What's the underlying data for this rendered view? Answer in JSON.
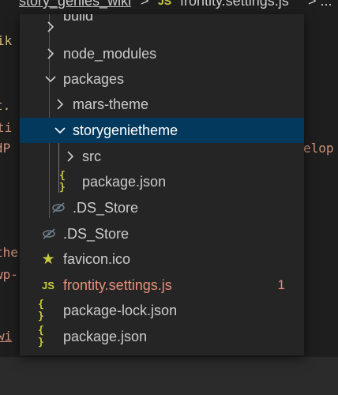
{
  "breadcrumb": {
    "folder": "story_genies_wiki",
    "separator": ">",
    "file_icon": "JS",
    "file": "frontity.settings.js",
    "more": "> ..."
  },
  "background_code": {
    "fragments": [
      "ik",
      "t.",
      "ti",
      "dP",
      "elop",
      "the",
      "wp-",
      "wi"
    ]
  },
  "tree": {
    "items": [
      {
        "name": "build",
        "kind": "folder",
        "state": "collapsed",
        "icon": "chevron-right"
      },
      {
        "name": "node_modules",
        "kind": "folder",
        "state": "collapsed",
        "icon": "chevron-right"
      },
      {
        "name": "packages",
        "kind": "folder",
        "state": "expanded",
        "icon": "chevron-down"
      },
      {
        "name": "mars-theme",
        "kind": "folder",
        "state": "collapsed",
        "icon": "chevron-right"
      },
      {
        "name": "storygenietheme",
        "kind": "folder",
        "state": "expanded",
        "icon": "chevron-down",
        "selected": true
      },
      {
        "name": "src",
        "kind": "folder",
        "state": "collapsed",
        "icon": "chevron-right"
      },
      {
        "name": "package.json",
        "kind": "file",
        "icon": "json",
        "icon_text": "{ }"
      },
      {
        "name": ".DS_Store",
        "kind": "file",
        "icon": "hidden"
      },
      {
        "name": ".DS_Store",
        "kind": "file",
        "icon": "hidden"
      },
      {
        "name": "favicon.ico",
        "kind": "file",
        "icon": "star"
      },
      {
        "name": "frontity.settings.js",
        "kind": "file",
        "icon": "js",
        "icon_text": "JS",
        "badge": "1",
        "status": "error"
      },
      {
        "name": "package-lock.json",
        "kind": "file",
        "icon": "json",
        "icon_text": "{ }"
      },
      {
        "name": "package.json",
        "kind": "file",
        "icon": "json",
        "icon_text": "{ }"
      }
    ]
  },
  "colors": {
    "popup_bg": "#252526",
    "selected_bg": "#04395e",
    "text": "#cccccc",
    "error_text": "#e8907a",
    "icon_yellow": "#cbcb41",
    "hidden_icon": "#6e7f8d"
  }
}
